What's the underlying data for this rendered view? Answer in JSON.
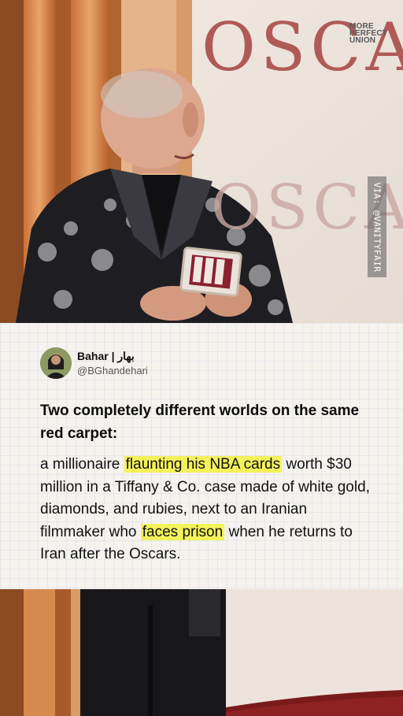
{
  "photo": {
    "brand_logo": [
      "MORE",
      "PERFECT",
      "UNION"
    ],
    "backdrop_text": "OSCA",
    "credit": "VIA: @VANITYFAIR"
  },
  "tweet": {
    "display_name": "Bahar | بهار",
    "handle": "@BGhandehari",
    "headline": "Two completely different worlds on the same red carpet:",
    "body": {
      "t1": "a millionaire ",
      "h1": "flaunting his NBA cards",
      "t2": " worth $30 million in a Tiffany & Co. case made of white gold, diamonds, and rubies, next to an Iranian filmmaker who ",
      "h2": "faces prison",
      "t3": " when he returns to Iran after the Oscars."
    },
    "highlight_color": "#f4f25a"
  },
  "colors": {
    "card_background": "#f6f3ef",
    "backdrop_text": "#b05a58",
    "jacket": "#1e1e22"
  }
}
